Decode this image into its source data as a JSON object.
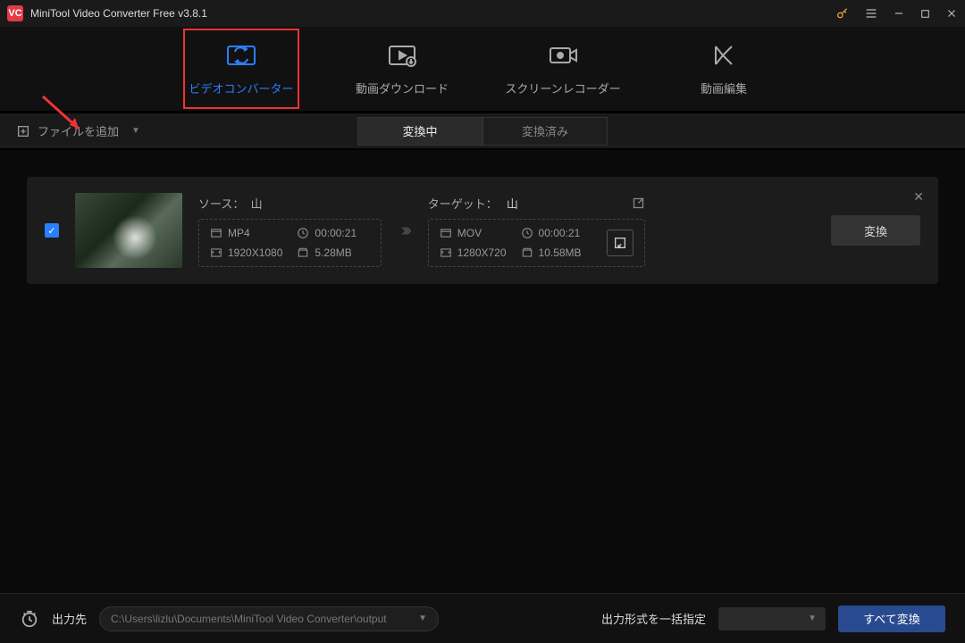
{
  "app": {
    "title": "MiniTool Video Converter Free v3.8.1"
  },
  "tabs": {
    "converter": "ビデオコンバーター",
    "download": "動画ダウンロード",
    "recorder": "スクリーンレコーダー",
    "editor": "動画編集"
  },
  "toolbar": {
    "add_file": "ファイルを追加"
  },
  "subtabs": {
    "converting": "変換中",
    "done": "変換済み"
  },
  "item": {
    "source_label": "ソース：",
    "source_name": "山",
    "source_format": "MP4",
    "source_duration": "00:00:21",
    "source_resolution": "1920X1080",
    "source_size": "5.28MB",
    "target_label": "ターゲット：",
    "target_name": "山",
    "target_format": "MOV",
    "target_duration": "00:00:21",
    "target_resolution": "1280X720",
    "target_size": "10.58MB",
    "convert_btn": "変換"
  },
  "bottombar": {
    "output_label": "出力先",
    "output_path": "C:\\Users\\lizlu\\Documents\\MiniTool Video Converter\\output",
    "batch_label": "出力形式を一括指定",
    "convert_all": "すべて変換"
  }
}
